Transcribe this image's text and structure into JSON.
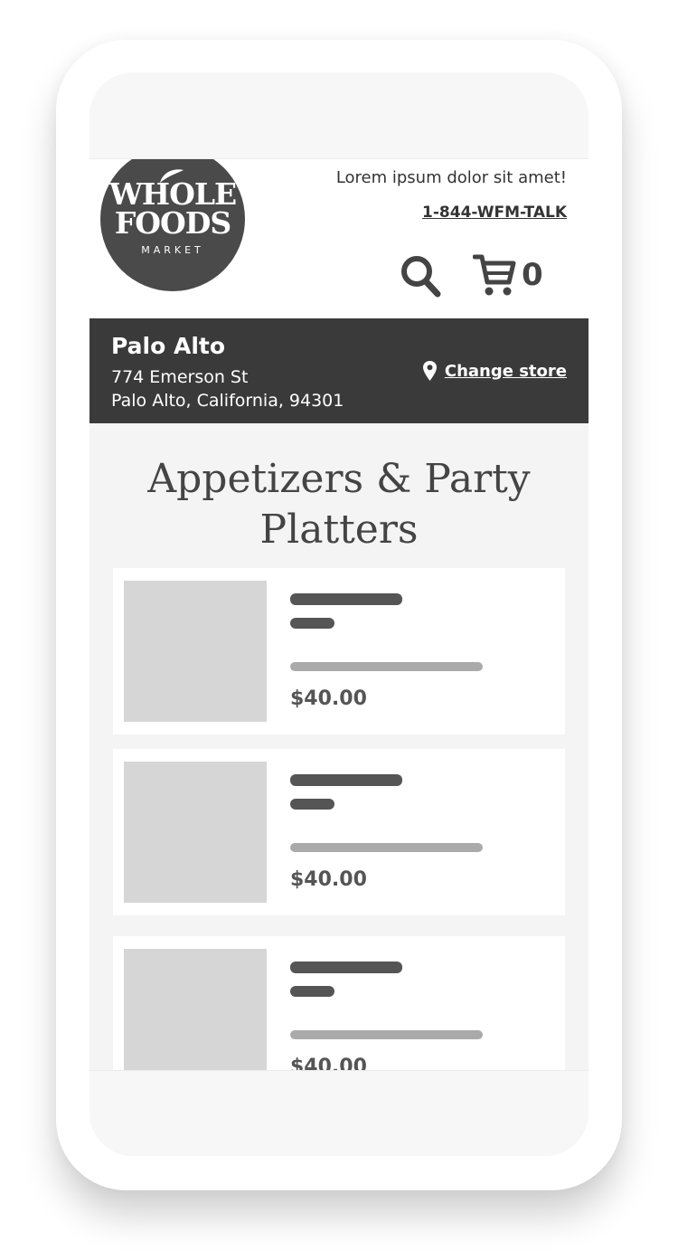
{
  "header": {
    "logo": {
      "line1": "WHOLE",
      "line2": "FOODS",
      "line3": "MARKET"
    },
    "tagline": "Lorem ipsum dolor sit amet!",
    "phone": "1-844-WFM-TALK",
    "search_icon": "search-icon",
    "cart_icon": "cart-icon",
    "cart_count": "0"
  },
  "store": {
    "name": "Palo Alto",
    "address_line1": "774 Emerson St",
    "address_line2": "Palo Alto, California, 94301",
    "change_label": "Change store",
    "pin_icon": "map-pin-icon"
  },
  "page": {
    "title": "Appetizers & Party Platters"
  },
  "products": [
    {
      "price": "$40.00"
    },
    {
      "price": "$40.00"
    },
    {
      "price": "$40.00"
    }
  ],
  "colors": {
    "store_bar": "#3a3a3a",
    "logo_bg": "#4a4a4a",
    "content_bg": "#f4f4f4",
    "placeholder": "#d6d6d6"
  }
}
